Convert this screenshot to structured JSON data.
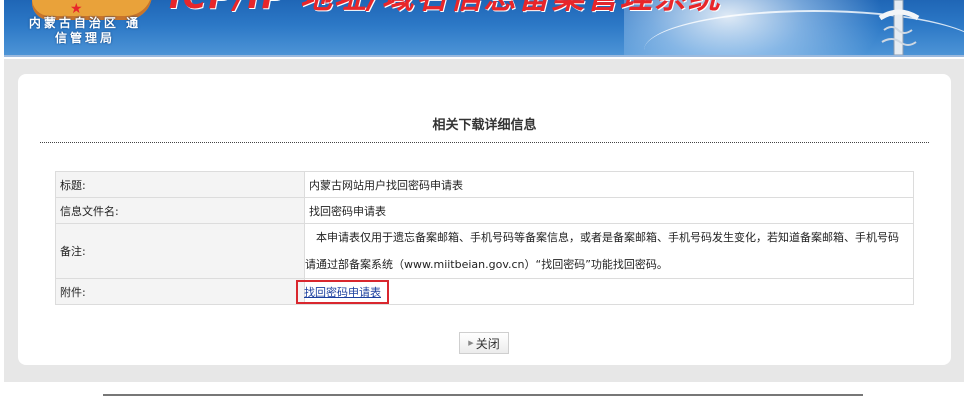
{
  "header": {
    "org_name": "内蒙古自治区 通信管理局",
    "system_title": "ICP/IP 地址/域名信息备案管理系统"
  },
  "panel": {
    "title": "相关下载详细信息"
  },
  "details": {
    "title_label": "标题:",
    "title_value": "内蒙古网站用户找回密码申请表",
    "file_label": "信息文件名:",
    "file_value": "找回密码申请表",
    "note_label": "备注:",
    "note_value": "本申请表仅用于遗忘备案邮箱、手机号码等备案信息，或者是备案邮箱、手机号码发生变化，若知道备案邮箱、手机号码请通过部备案系统（www.miitbeian.gov.cn）“找回密码”功能找回密码。",
    "attachment_label": "附件:",
    "attachment_link": "找回密码申请表"
  },
  "buttons": {
    "close": "关闭"
  },
  "colors": {
    "banner_blue": "#2c78c6",
    "title_red": "#e8262a",
    "highlight_red": "#d9272e",
    "link_blue": "#1b3f9e"
  }
}
